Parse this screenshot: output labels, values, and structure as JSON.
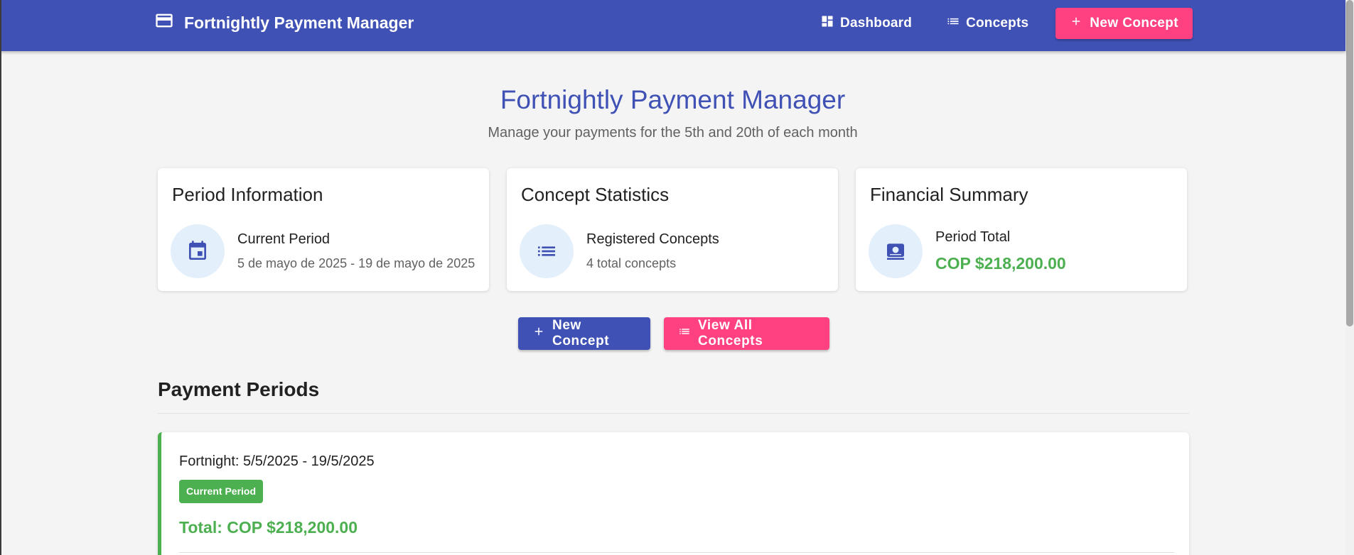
{
  "appbar": {
    "brand_title": "Fortnightly Payment Manager",
    "nav": {
      "dashboard_label": "Dashboard",
      "concepts_label": "Concepts",
      "new_concept_label": "New Concept"
    }
  },
  "header": {
    "title": "Fortnightly Payment Manager",
    "subtitle": "Manage your payments for the 5th and 20th of each month"
  },
  "cards": [
    {
      "title": "Period Information",
      "icon": "calendar-icon",
      "label": "Current Period",
      "value": "5 de mayo de 2025 - 19 de mayo de 2025"
    },
    {
      "title": "Concept Statistics",
      "icon": "list-icon",
      "label": "Registered Concepts",
      "value": "4 total concepts"
    },
    {
      "title": "Financial Summary",
      "icon": "money-icon",
      "label": "Period Total",
      "value": "COP $218,200.00"
    }
  ],
  "actions": {
    "new_concept_label": "New Concept",
    "view_all_label": "View All Concepts"
  },
  "periods": {
    "section_title": "Payment Periods",
    "items": [
      {
        "title": "Fortnight: 5/5/2025 - 19/5/2025",
        "badge": "Current Period",
        "total": "Total: COP $218,200.00"
      }
    ]
  },
  "colors": {
    "primary": "#3f51b5",
    "accent": "#ff4081",
    "success": "#4caf50",
    "icon_bg": "#e3effb"
  }
}
